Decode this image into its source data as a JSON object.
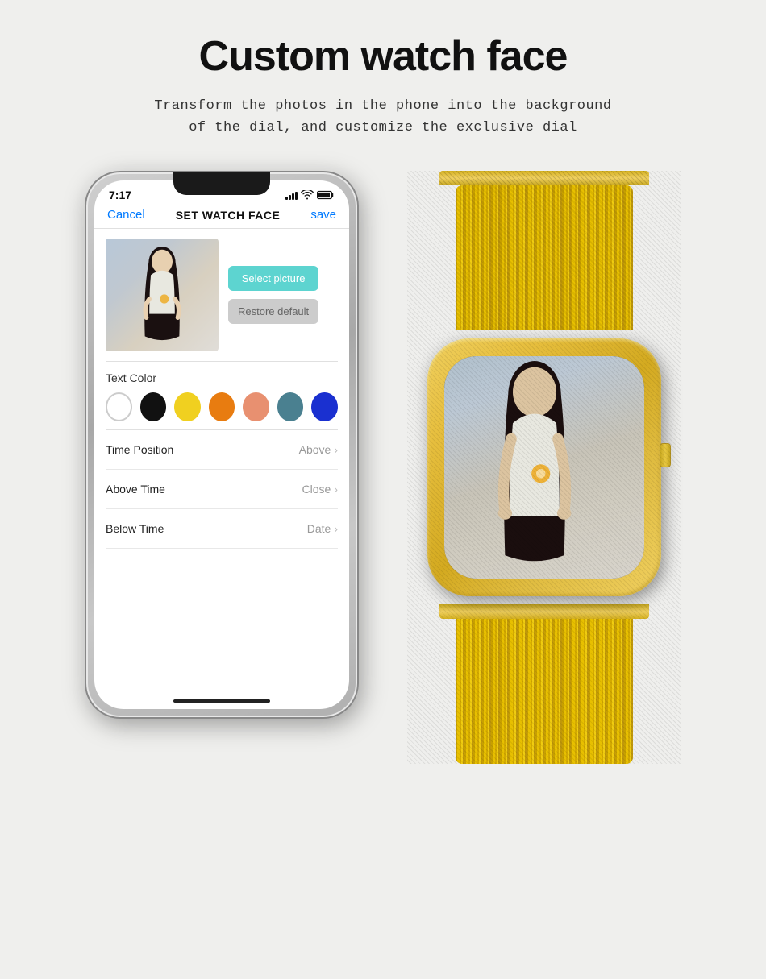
{
  "page": {
    "background": "#efefed"
  },
  "header": {
    "title": "Custom watch face",
    "subtitle_line1": "Transform the photos in the phone into the background",
    "subtitle_line2": "of the dial, and customize the exclusive dial"
  },
  "phone": {
    "status_time": "7:17",
    "nav_cancel": "Cancel",
    "nav_title": "SET WATCH FACE",
    "nav_save": "save",
    "btn_select": "Select picture",
    "btn_restore": "Restore default",
    "text_color_label": "Text Color",
    "colors": [
      "white",
      "black",
      "yellow",
      "orange",
      "salmon",
      "teal",
      "blue"
    ],
    "settings": [
      {
        "label": "Time Position",
        "value": "Above"
      },
      {
        "label": "Above Time",
        "value": "Close"
      },
      {
        "label": "Below Time",
        "value": "Date"
      }
    ]
  }
}
